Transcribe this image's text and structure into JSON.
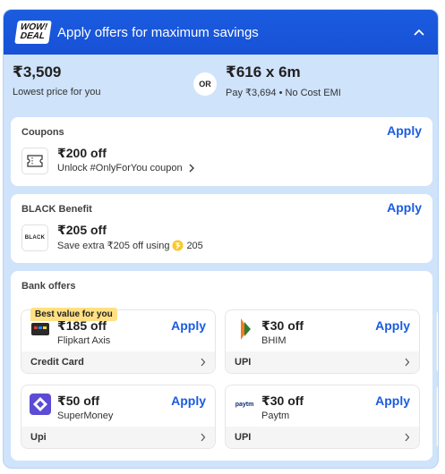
{
  "header": {
    "logo_line1": "WOW!",
    "logo_line2": "DEAL",
    "title": "Apply offers for maximum savings"
  },
  "summary": {
    "lowest_price": "₹3,509",
    "lowest_label": "Lowest price for you",
    "or": "OR",
    "emi_price": "₹616 x 6m",
    "emi_label": "Pay ₹3,694 • No Cost EMI"
  },
  "coupons": {
    "label": "Coupons",
    "apply": "Apply",
    "title": "₹200 off",
    "desc": "Unlock #OnlyForYou coupon"
  },
  "black": {
    "label": "BLACK Benefit",
    "apply": "Apply",
    "icon_text": "BLACK",
    "title": "₹205 off",
    "desc": "Save extra ₹205 off using",
    "coins": "205"
  },
  "bank": {
    "label": "Bank offers",
    "best_tag": "Best value for you",
    "offers": [
      {
        "title": "₹185 off",
        "name": "Flipkart Axis",
        "foot": "Credit Card",
        "apply": "Apply"
      },
      {
        "title": "₹30 off",
        "name": "BHIM",
        "foot": "UPI",
        "apply": "Apply"
      },
      {
        "title": "₹50 off",
        "name": "SuperMoney",
        "foot": "Upi",
        "apply": "Apply"
      },
      {
        "title": "₹30 off",
        "name": "Paytm",
        "foot": "UPI",
        "apply": "Apply",
        "logo_text": "paytm"
      }
    ]
  },
  "colors": {
    "accent": "#1a5ce0",
    "panel_bg": "#cfe3fb",
    "tag": "#ffe082"
  }
}
